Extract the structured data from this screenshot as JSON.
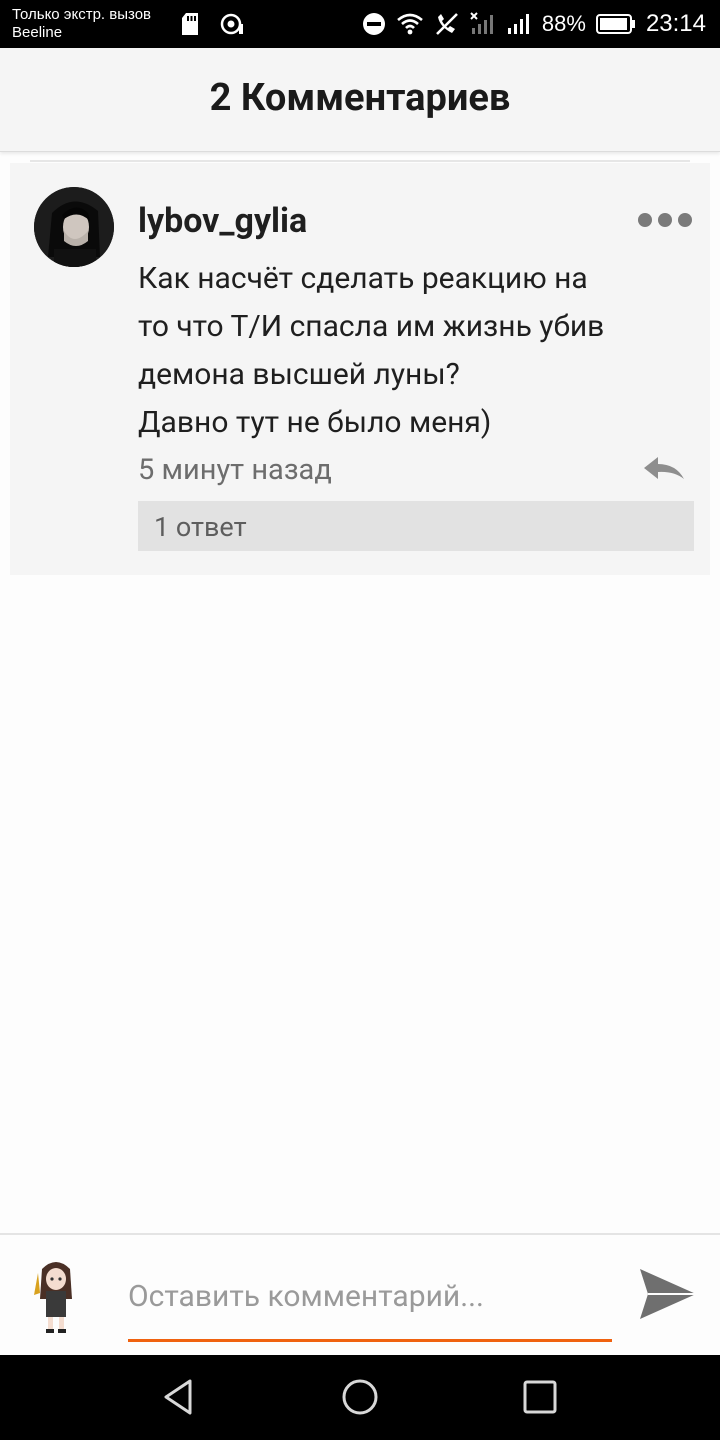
{
  "status_bar": {
    "carrier_line1": "Только экстр. вызов",
    "carrier_line2": "Beeline",
    "battery_percent": "88%",
    "time": "23:14",
    "icons": [
      "sd-card-icon",
      "nfc-icon",
      "do-not-disturb-icon",
      "wifi-icon",
      "call-off-icon",
      "signal-icon",
      "battery-icon"
    ]
  },
  "header": {
    "title": "2 Комментариев"
  },
  "comment": {
    "username": "lybov_gylia",
    "text_lines": [
      "Как насчёт сделать реакцию на",
      "то что Т/И спасла им жизнь убив",
      "демона высшей луны?",
      "Давно тут не было меня)"
    ],
    "timestamp": "5 минут назад",
    "replies_label": "1 ответ"
  },
  "input_bar": {
    "placeholder": "Оставить комментарий...",
    "accent_color": "#f0620f"
  },
  "nav_bar": {
    "icons": [
      "back-icon",
      "home-icon",
      "recent-apps-icon"
    ]
  }
}
